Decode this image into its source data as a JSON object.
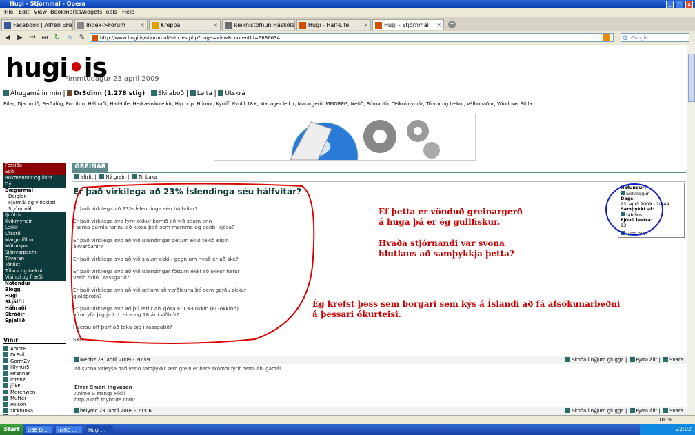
{
  "window": {
    "title": "Hugi - Stjórnmál - Opera"
  },
  "menu": [
    "File",
    "Edit",
    "View",
    "Bookmarks",
    "Widgets",
    "Tools",
    "Help"
  ],
  "tabs": [
    {
      "label": "Facebook | Alfreð Ellerts...",
      "color": "#3b5998"
    },
    {
      "label": "Index->Forum",
      "color": "#888888"
    },
    {
      "label": "Kreppa",
      "color": "#e0a000"
    },
    {
      "label": "Reiknistofnun Háskóla Ís...",
      "color": "#6b6b6b"
    },
    {
      "label": "Hugi - Half-Life",
      "color": "#d05000"
    },
    {
      "label": "Hugi - Stjórnmál",
      "color": "#d05000"
    }
  ],
  "address": {
    "url": "http://www.hugi.is/stjornmal/articles.php?page=view&contentId=6636634",
    "search_placeholder": "Google"
  },
  "site": {
    "logo_a": "hugi",
    "logo_dot": "•",
    "logo_b": "is",
    "date": "Fimmtudagur 23.apríl 2009"
  },
  "topnav": {
    "items": [
      "Áhugamálin mín",
      "Dr3dinn (1.278 stig)",
      "Skilaboð",
      "Leita",
      "Útskrá"
    ]
  },
  "categories": "Bílar, Djammið, Ferðalög, Forritun, Háhraði, Half-Life, Herkænskuleikir, Hip hop, Húmor, Kynlíf, Kynlíf 18+, Manager leikir, Matargerð, MMORPG, Netið, Rómantík, Teiknimyndir, Tölvur og tækni, Vélbúnaður, Windows  Stilla",
  "sidebar": {
    "items": [
      {
        "label": "Forsíða",
        "style": "red"
      },
      {
        "label": "Egó",
        "style": "red"
      },
      {
        "label": "Bókmenntir og listir",
        "style": "dark"
      },
      {
        "label": "Dýr",
        "style": "dark"
      },
      {
        "label": "Dægurmál",
        "style": "bold"
      },
      {
        "label": "Deiglan",
        "style": "white"
      },
      {
        "label": "Fjármál og viðskipti",
        "style": "white"
      },
      {
        "label": "Stjórnmál",
        "style": "white"
      },
      {
        "label": "Íþróttir",
        "style": "dark"
      },
      {
        "label": "Kvikmyndir",
        "style": "dark"
      },
      {
        "label": "Leikir",
        "style": "dark"
      },
      {
        "label": "Lífsstíll",
        "style": "dark"
      },
      {
        "label": "Margmiðlun",
        "style": "dark"
      },
      {
        "label": "Mótorsport",
        "style": "dark"
      },
      {
        "label": "Sjónvarpsefni",
        "style": "dark"
      },
      {
        "label": "Tilveran",
        "style": "dark"
      },
      {
        "label": "Tónlist",
        "style": "dark"
      },
      {
        "label": "Tölvur og tækni",
        "style": "dark"
      },
      {
        "label": "Vísindi og fræði",
        "style": "dark"
      },
      {
        "label": "Notendur",
        "style": "bold"
      },
      {
        "label": "Blogg",
        "style": "bold"
      },
      {
        "label": "Hugi",
        "style": "bold"
      },
      {
        "label": "Skjálfti",
        "style": "bold"
      },
      {
        "label": "Háhraði",
        "style": "bold"
      },
      {
        "label": "Skráðir",
        "style": "bold"
      },
      {
        "label": "Spjallið",
        "style": "bold"
      }
    ],
    "vinir_heading": "Vinir",
    "vinir": [
      "AmorP",
      "DrEvil",
      "GormZy",
      "Hlynur5",
      "Hrannar",
      "intenz",
      "jökEr",
      "Merenwen",
      "Mutter",
      "Poison",
      "zickfunka",
      "Ziffius"
    ]
  },
  "greinar": {
    "header": "GREINAR",
    "subnav": [
      "Yfirlit",
      "Ný grein",
      "Til baka"
    ]
  },
  "article": {
    "title": "Er það virkilega að 23% Íslendinga séu hálfvitar?",
    "lines": [
      "Er það virkilega að 23% Íslendinga séu hálfvitar?",
      "Er það virkilega svo fyrir okkur komið að við séum enn",
      "í sama gamla farinu að kjósa það sem mamma og pabbi kjósa?",
      "Er það virkilega svo að við Íslendingar getum ekki tekið eigin",
      "ákvarðanir?",
      "Er það virkilega svo að við sjáum ekki í gegn um hvað er að ske?",
      "Er það virkilega svo að við Íslendingar föttum ekki að okkur hefur",
      "verið riðið í rassgatið?",
      "Er það virkilega svo að við ætlum að verðlauna þá sem gerðu okkur",
      "gjaldþrota?",
      "Er það virkilega svo að þú ætlir að kjósa FUCK-Lokkin (FL-okkinn)",
      "aftur yfir þig ja t.d. eins og 18 ár í viðbót?",
      "Hversu oft þarf að taka þig í rassgatið?",
      "SKO"
    ]
  },
  "author": {
    "hofundur_label": "Höfundur:",
    "hofundur": "Eldveggur",
    "dags_label": "Dags:",
    "dags": "23. apríl 2009 - 20:44",
    "samth_label": "Samþykkt af:",
    "samth": "fabilius",
    "fjoldi_label": "Fjöldi lestra:",
    "fjoldi": "93",
    "gefa": "Gefa álit"
  },
  "notes": {
    "note1_a": "Ef þetta er vönduð greinargerð á huga þá er ég gullfiskur.",
    "note1_b": "Hvaða stjórnandi var svona hlutlaus að samþykkja þetta?",
    "note2": "Ég krefst þess sem borgari  sem kýs á Íslandi að fá afsökunarbeðni á þessari ókurteisi."
  },
  "comments": [
    {
      "header": "Mephz 23. apríl 2009 - 20:59",
      "text": "að svona vitleysa hafi verið samþykkt sem grein er bara skömm fyrir þetta áhugamál",
      "sig_sep": "------",
      "sig_name": "Elvar Smári Ingvason",
      "sig_line2": "Anime & Manga Fíkill",
      "sig_url": "http://kaffi.mybrute.com/",
      "actions": [
        "Skoða í nýjum glugga",
        "Fyrra álit",
        "Svara"
      ]
    },
    {
      "header": "helymc 23. apríl 2009 - 21:06",
      "actions": [
        "Skoða í nýjum glugga",
        "Fyrra álit",
        "Svara"
      ]
    }
  ],
  "status": {
    "zoom": "100%"
  },
  "taskbar": {
    "start": "Start",
    "buttons": [
      "USB D...",
      "mIRC ...",
      "Hugi ..."
    ],
    "clock": "22:02"
  }
}
